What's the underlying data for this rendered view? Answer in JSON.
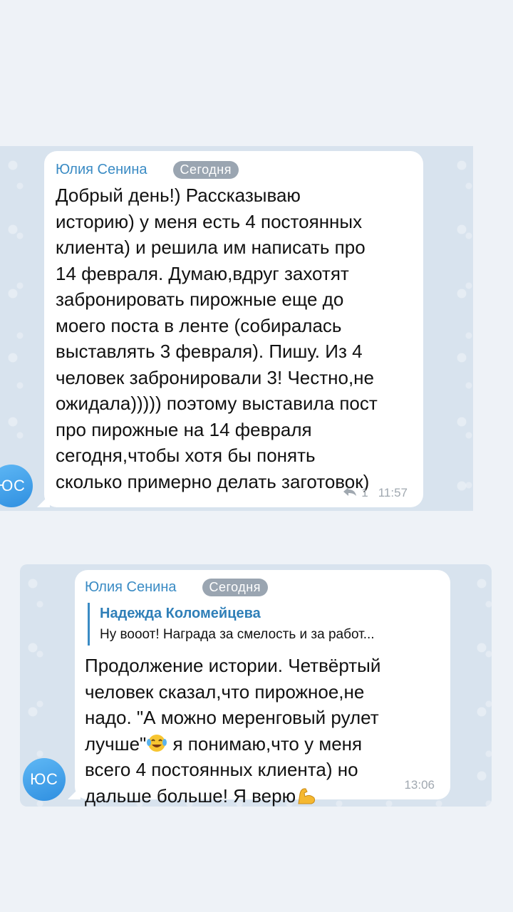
{
  "messages": [
    {
      "sender": "Юлия Сенина",
      "date_label": "Сегодня",
      "text": "Добрый день!) Рассказываю\nисторию) у меня есть 4 постоянных\nклиента) и решила им написать про\n14 февраля. Думаю,вдруг захотят\nзабронировать пирожные еще до\nмоего поста в ленте (собиралась\nвыставлять 3 февраля). Пишу. Из 4\nчеловек забронировали 3! Честно,не\nожидала))))) поэтому выставила пост\nпро пирожные на 14 февраля\nсегодня,чтобы хотя бы понять\nсколько примерно делать заготовок)",
      "reply_count": "1",
      "time": "11:57",
      "avatar_initials": "ЮС"
    },
    {
      "sender": "Юлия Сенина",
      "date_label": "Сегодня",
      "reply_to": {
        "name": "Надежда Коломейцева",
        "text": "Ну вооот! Награда за смелость и за работ..."
      },
      "text_part1": "Продолжение истории. Четвёртый\nчеловек сказал,что пирожное,не\nнадо. \"А можно меренговый рулет\nлучше\"",
      "text_part2": " я понимаю,что у меня\nвсего 4 постоянных клиента) но\nдальше больше! Я верю",
      "emoji_1": "face-with-tears-of-joy-icon",
      "emoji_2": "flexed-biceps-icon",
      "time": "13:06",
      "avatar_initials": "ЮС"
    }
  ],
  "colors": {
    "accent": "#3a8bc4",
    "chat_background": "#d8e3ee",
    "page_background": "#eef2f7"
  }
}
